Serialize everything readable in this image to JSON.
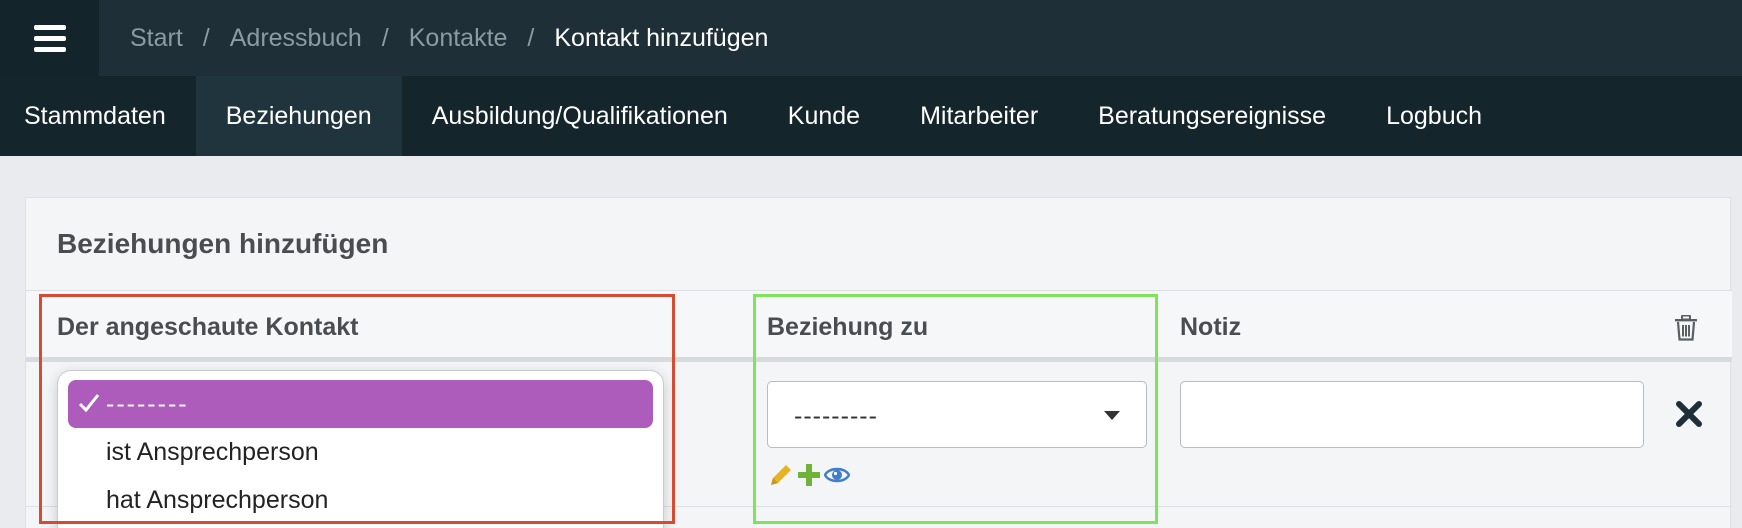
{
  "topbar": {
    "breadcrumb": [
      "Start",
      "Adressbuch",
      "Kontakte"
    ],
    "breadcrumb_current": "Kontakt hinzufügen",
    "separator": "/"
  },
  "tabs": [
    {
      "label": "Stammdaten",
      "active": false
    },
    {
      "label": "Beziehungen",
      "active": true
    },
    {
      "label": "Ausbildung/Qualifikationen",
      "active": false
    },
    {
      "label": "Kunde",
      "active": false
    },
    {
      "label": "Mitarbeiter",
      "active": false
    },
    {
      "label": "Beratungsereignisse",
      "active": false
    },
    {
      "label": "Logbuch",
      "active": false
    }
  ],
  "card": {
    "title": "Beziehungen hinzufügen",
    "columns": {
      "contact": "Der angeschaute Kontakt",
      "relation": "Beziehung zu",
      "note": "Notiz"
    }
  },
  "row": {
    "relation_select_value": "---------",
    "note_value": ""
  },
  "dropdown": {
    "options": [
      "--------",
      "ist Ansprechperson",
      "hat Ansprechperson"
    ],
    "selected_index": 0
  },
  "colors": {
    "topbar": "#1e2f37",
    "tabbar": "#14252c",
    "selected_option": "#ad5cbc",
    "highlight_red": "#d94a33",
    "highlight_green": "#7fe35c",
    "pencil_icon": "#e6b422",
    "plus_icon": "#6fb338",
    "eye_icon": "#3f7ecb"
  },
  "icons": [
    "hamburger-menu-icon",
    "trash-icon",
    "pencil-icon",
    "plus-icon",
    "eye-icon",
    "close-icon",
    "checkmark-icon",
    "caret-down-icon"
  ]
}
